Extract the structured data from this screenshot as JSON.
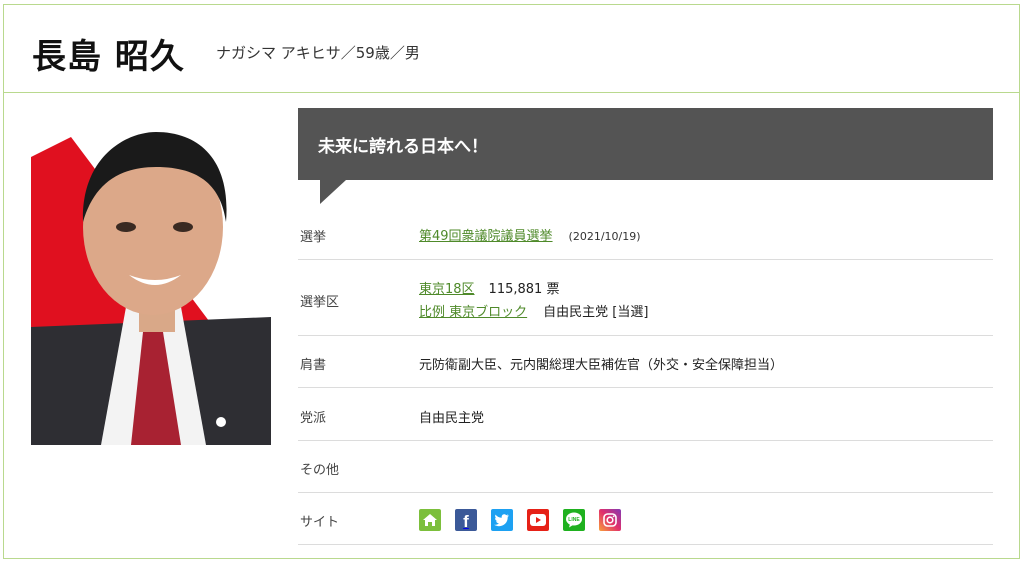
{
  "profile": {
    "name": "長島 昭久",
    "kana_age_sex": "ナガシマ アキヒサ／59歳／男"
  },
  "slogan": "未来に誇れる日本へ！",
  "rows": {
    "election": {
      "label": "選挙",
      "link": "第49回衆議院議員選挙",
      "date": "(2021/10/19)"
    },
    "district": {
      "label": "選挙区",
      "district_link": "東京18区",
      "votes": "115,881 票",
      "pr_link": "比例 東京ブロック",
      "party_result": "自由民主党 [当選]"
    },
    "title": {
      "label": "肩書",
      "value": "元防衛副大臣、元内閣総理大臣補佐官（外交・安全保障担当）"
    },
    "party": {
      "label": "党派",
      "value": "自由民主党"
    },
    "other": {
      "label": "その他",
      "value": ""
    },
    "site": {
      "label": "サイト"
    }
  },
  "site_icons": [
    "home-icon",
    "facebook-icon",
    "twitter-icon",
    "youtube-icon",
    "line-icon",
    "instagram-icon"
  ],
  "site_icon_text": {
    "facebook": "f",
    "line": "LINE"
  },
  "colors": {
    "border_green": "#b9d98e",
    "link_green": "#4f8a2a",
    "slogan_bg": "#545454",
    "home": "#7cbf3c",
    "facebook": "#3b5998",
    "twitter": "#1da1f2",
    "youtube": "#e62117",
    "line": "#1fb11f",
    "instagram": "#c13584"
  }
}
